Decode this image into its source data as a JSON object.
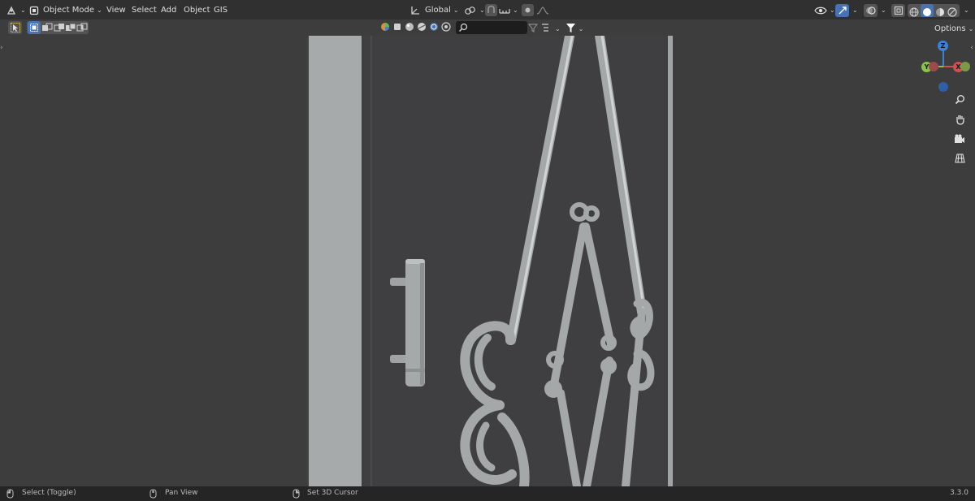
{
  "header": {
    "mode": "Object Mode",
    "menus": [
      "View",
      "Select",
      "Add",
      "Object",
      "GIS"
    ],
    "orientation": "Global",
    "options": "Options"
  },
  "status": {
    "left_click": "Select (Toggle)",
    "middle_click": "Pan View",
    "right_click": "Set 3D Cursor",
    "version": "3.3.0"
  },
  "gizmo": {
    "z": "Z",
    "y": "Y",
    "x": "X"
  },
  "colors": {
    "accent": "#4772b3",
    "x_axis": "#d05050",
    "y_axis": "#8bc34a",
    "z_axis": "#3f7fd6",
    "header_bg": "#303030",
    "viewport_bg": "#3d3d3d"
  },
  "icons": [
    "editor-type-icon",
    "object-mode-icon",
    "transform-orientation-icon",
    "pivot-icon",
    "snap-icon",
    "proportional-edit-icon",
    "visibility-icon",
    "gizmo-icon",
    "overlay-icon",
    "xray-icon",
    "wireframe-shading-icon",
    "solid-shading-icon",
    "material-shading-icon",
    "rendered-shading-icon",
    "select-tool-icon",
    "zoom-icon",
    "pan-hand-icon",
    "camera-icon",
    "ortho-grid-icon",
    "mouse-left-icon",
    "mouse-middle-icon",
    "mouse-right-icon"
  ]
}
